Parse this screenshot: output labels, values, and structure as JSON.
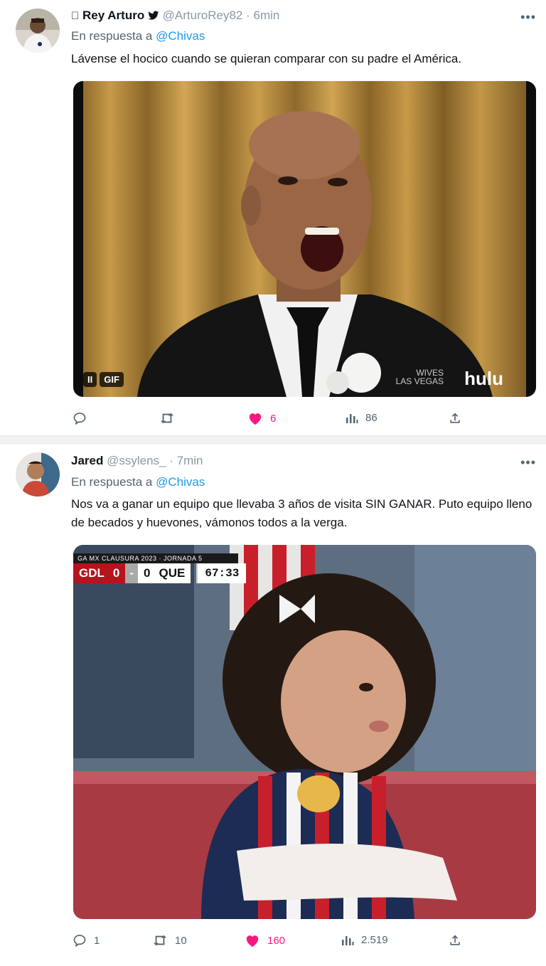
{
  "tweets": [
    {
      "name": "Rey Arturo",
      "handle": "@ArturoRey82",
      "time": "· 6min",
      "reply_prefix": "En respuesta a",
      "reply_to": "@Chivas",
      "text": "Lávense el hocico cuando se quieran comparar con su padre el América.",
      "media": {
        "type": "gif",
        "badge_pause": "II",
        "badge_label": "GIF",
        "watermark": "hulu",
        "watermark_small": "WIVES\nLAS VEGAS"
      },
      "actions": {
        "replies": "",
        "retweets": "",
        "likes": "6",
        "views": "86"
      },
      "liked": true
    },
    {
      "name": "Jared",
      "handle": "@ssylens_",
      "time": "· 7min",
      "reply_prefix": "En respuesta a",
      "reply_to": "@Chivas",
      "text": "Nos va a ganar un equipo que llevaba 3 años de visita SIN GANAR. Puto equipo lleno de becados y huevones, vámonos todos a la verga.",
      "media": {
        "type": "image",
        "scorebug": {
          "league": "GA MX CLAUSURA 2023 · JORNADA 5",
          "home": "GDL",
          "home_score": "0",
          "separator": "-",
          "away_score": "0",
          "away": "QUE",
          "clock": "67:33"
        }
      },
      "actions": {
        "replies": "1",
        "retweets": "10",
        "likes": "160",
        "views": "2.519"
      },
      "liked": true
    }
  ],
  "colors": {
    "accent": "#1d9bf0",
    "like": "#f91880",
    "muted": "#536471"
  },
  "icons": [
    "verified-apple-icon",
    "twitter-bird-icon",
    "more-icon",
    "reply-icon",
    "retweet-icon",
    "heart-icon",
    "views-icon",
    "share-icon"
  ]
}
